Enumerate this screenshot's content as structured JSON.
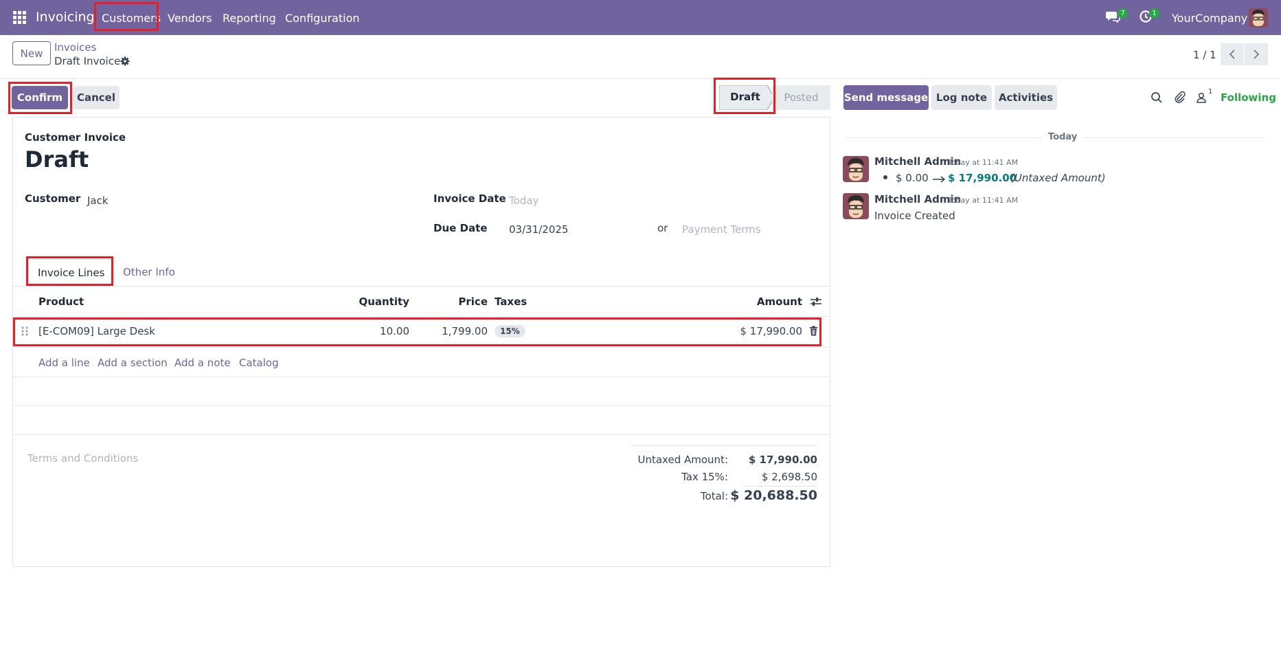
{
  "navbar": {
    "app_name": "Invoicing",
    "menu": [
      "Customers",
      "Vendors",
      "Reporting",
      "Configuration"
    ],
    "messages_badge": "7",
    "activities_badge": "1",
    "company": "YourCompany"
  },
  "control_panel": {
    "new_label": "New",
    "breadcrumb_parent": "Invoices",
    "breadcrumb_current": "Draft Invoice",
    "pager": "1 / 1"
  },
  "actions": {
    "confirm": "Confirm",
    "cancel": "Cancel"
  },
  "statusbar": {
    "draft": "Draft",
    "posted": "Posted"
  },
  "form": {
    "doc_type": "Customer Invoice",
    "name": "Draft",
    "customer_label": "Customer",
    "customer_value": "Jack",
    "invoice_date_label": "Invoice Date",
    "invoice_date_placeholder": "Today",
    "due_date_label": "Due Date",
    "due_date_value": "03/31/2025",
    "or_label": "or",
    "payment_terms_placeholder": "Payment Terms",
    "tabs": [
      "Invoice Lines",
      "Other Info"
    ],
    "columns": {
      "product": "Product",
      "quantity": "Quantity",
      "price": "Price",
      "taxes": "Taxes",
      "amount": "Amount"
    },
    "lines": [
      {
        "product": "[E-COM09] Large Desk",
        "quantity": "10.00",
        "price": "1,799.00",
        "tax": "15%",
        "amount": "$ 17,990.00"
      }
    ],
    "add_links": [
      "Add a line",
      "Add a section",
      "Add a note",
      "Catalog"
    ],
    "terms_placeholder": "Terms and Conditions",
    "totals": {
      "untaxed_label": "Untaxed Amount:",
      "untaxed_value": "$ 17,990.00",
      "tax_label": "Tax 15%:",
      "tax_value": "$ 2,698.50",
      "total_label": "Total:",
      "total_value": "$ 20,688.50"
    }
  },
  "chatter": {
    "send_message": "Send message",
    "log_note": "Log note",
    "activities": "Activities",
    "followers_count": "1",
    "following": "Following",
    "date_separator": "Today",
    "messages": [
      {
        "author": "Mitchell Admin",
        "time": "Today at 11:41 AM",
        "old_value": "$ 0.00",
        "new_value": "$ 17,990.00",
        "field": "(Untaxed Amount)"
      },
      {
        "author": "Mitchell Admin",
        "time": "Today at 11:41 AM",
        "body": "Invoice Created"
      }
    ]
  },
  "colors": {
    "brand": "#71639e",
    "highlight": "#ee1c25",
    "success": "#28a745",
    "link_teal": "#017e84"
  }
}
